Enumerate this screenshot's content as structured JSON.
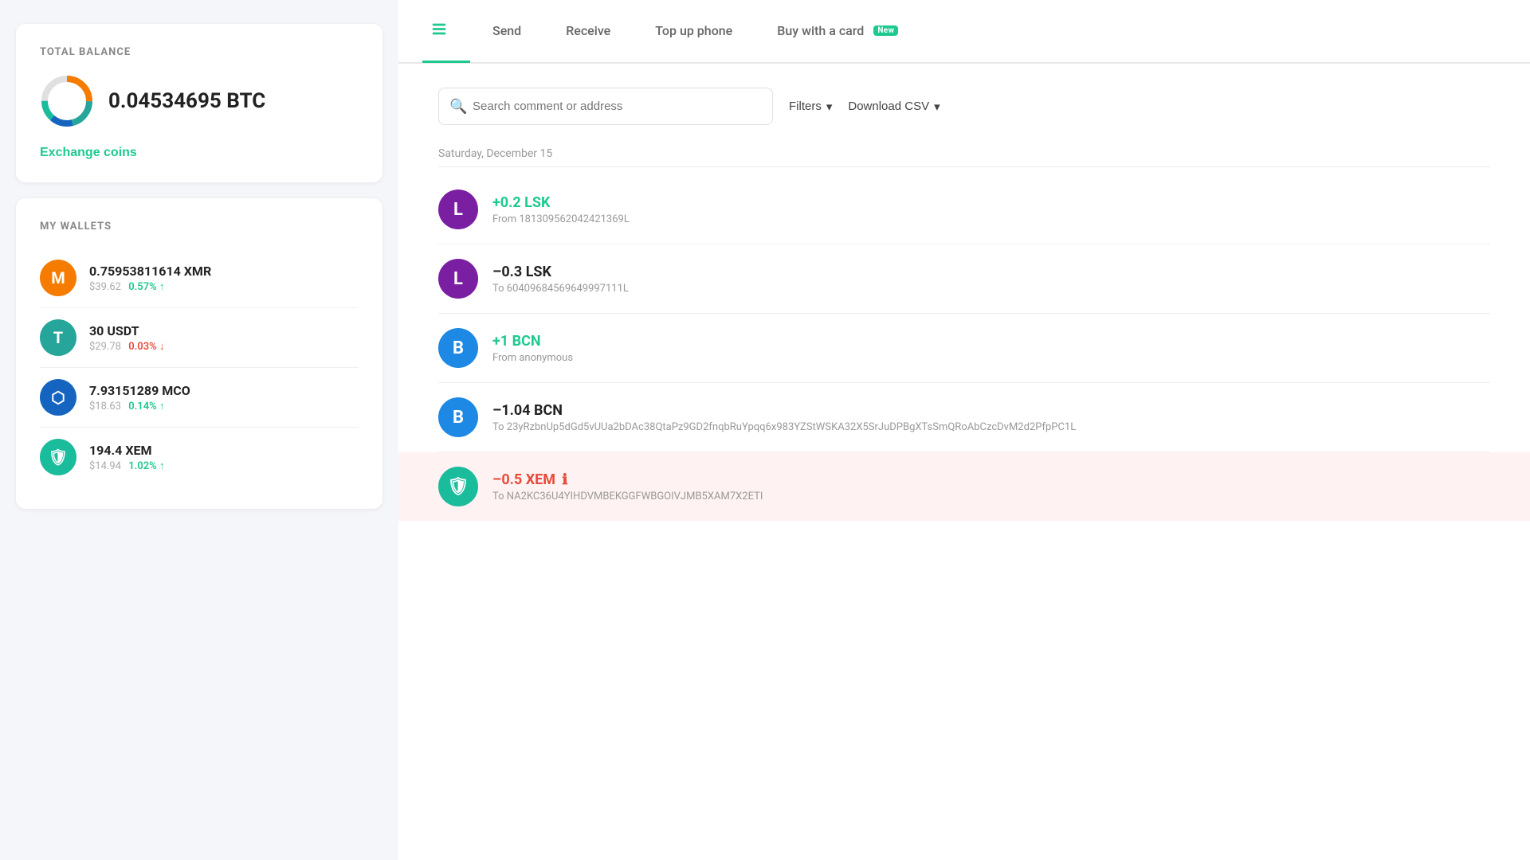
{
  "left": {
    "total_balance": {
      "title": "TOTAL BALANCE",
      "amount": "0.04534695 BTC",
      "exchange_label": "Exchange coins"
    },
    "wallets": {
      "title": "MY WALLETS",
      "items": [
        {
          "id": "xmr",
          "amount": "0.75953811614 XMR",
          "fiat": "$39.62",
          "change": "0.57% ↑",
          "change_dir": "up",
          "bg": "#f57c00",
          "letter": "M"
        },
        {
          "id": "usdt",
          "amount": "30 USDT",
          "fiat": "$29.78",
          "change": "0.03% ↓",
          "change_dir": "down",
          "bg": "#26a69a",
          "letter": "T"
        },
        {
          "id": "mco",
          "amount": "7.93151289 MCO",
          "fiat": "$18.63",
          "change": "0.14% ↑",
          "change_dir": "up",
          "bg": "#1565c0",
          "letter": "⬡"
        },
        {
          "id": "xem",
          "amount": "194.4 XEM",
          "fiat": "$14.94",
          "change": "1.02% ↑",
          "change_dir": "up",
          "bg": "#1abc9c",
          "letter": "🛡"
        }
      ]
    }
  },
  "right": {
    "tabs": [
      {
        "id": "history",
        "label": "",
        "icon": "list-icon",
        "active": true
      },
      {
        "id": "send",
        "label": "Send",
        "icon": null,
        "active": false
      },
      {
        "id": "receive",
        "label": "Receive",
        "icon": null,
        "active": false
      },
      {
        "id": "topup",
        "label": "Top up phone",
        "icon": null,
        "active": false,
        "badge": null
      },
      {
        "id": "buycard",
        "label": "Buy with a card",
        "icon": null,
        "active": false,
        "badge": "New"
      }
    ],
    "search": {
      "placeholder": "Search comment or address"
    },
    "filters_label": "Filters",
    "csv_label": "Download CSV",
    "date_label": "Saturday, December 15",
    "transactions": [
      {
        "id": "tx1",
        "amount": "+0.2 LSK",
        "direction": "positive",
        "description": "From 181309562042421369L",
        "bg": "#7b1fa2",
        "letter": "L",
        "error": false
      },
      {
        "id": "tx2",
        "amount": "–0.3 LSK",
        "direction": "negative",
        "description": "To 60409684569649997111L",
        "bg": "#7b1fa2",
        "letter": "L",
        "error": false
      },
      {
        "id": "tx3",
        "amount": "+1 BCN",
        "direction": "positive",
        "description": "From anonymous",
        "bg": "#1e88e5",
        "letter": "B",
        "error": false
      },
      {
        "id": "tx4",
        "amount": "–1.04 BCN",
        "direction": "negative",
        "description": "To 23yRzbnUp5dGd5vUUa2bDAc38QtaPz9GD2fnqbRuYpqq6x983YZStWSKA32X5SrJuDPBgXTsSmQRoAbCzcDvM2d2PfpPC1L",
        "bg": "#1e88e5",
        "letter": "B",
        "error": false
      },
      {
        "id": "tx5",
        "amount": "–0.5 XEM",
        "direction": "negative-error",
        "description": "To NA2KC36U4YIHDVMBEKGGFWBGOIVJMB5XAM7X2ETI",
        "bg": "#1abc9c",
        "letter": "🛡",
        "error": true
      }
    ]
  }
}
